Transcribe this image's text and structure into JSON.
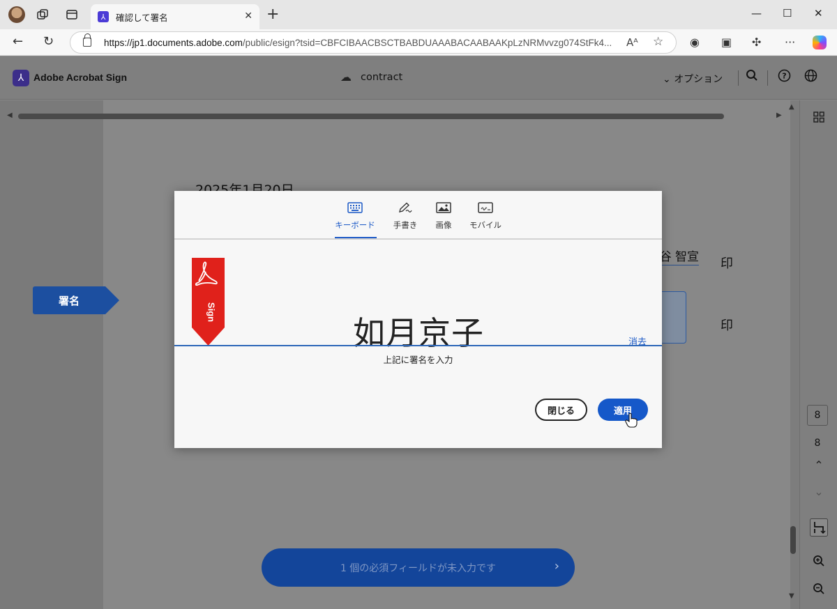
{
  "browser": {
    "tab_title": "確認して署名",
    "tab_close": "✕",
    "new_tab": "+",
    "url_host": "https://jp1.documents.adobe.com",
    "url_path": "/public/esign?tsid=CBFCIBAACBSCTBABDUAAABACAABAAKpLzNRMvvzg074StFk4...",
    "read_aloud": "Aᴬ",
    "window_minimize": "—",
    "window_maximize": "☐",
    "window_close": "✕"
  },
  "app_header": {
    "brand": "Adobe Acrobat Sign",
    "document_name": "contract",
    "options_label": "オプション"
  },
  "document": {
    "date": "2025年1月20日",
    "name_text": "谷 智宣",
    "seal_1": "印",
    "seal_2": "印",
    "sign_tag": "署名",
    "required_banner": "1 個の必須フィールドが未入力です"
  },
  "right_rail": {
    "current_page": "8",
    "total_pages": "8"
  },
  "signature_modal": {
    "tabs": [
      {
        "label": "キーボード",
        "icon": "keyboard-icon",
        "active": true
      },
      {
        "label": "手書き",
        "icon": "pen-icon",
        "active": false
      },
      {
        "label": "画像",
        "icon": "image-icon",
        "active": false
      },
      {
        "label": "モバイル",
        "icon": "mobile-icon",
        "active": false
      }
    ],
    "ribbon_text": "Sign",
    "signature_value": "如月京子",
    "clear_label": "消去",
    "caption": "上記に署名を入力",
    "close_button": "閉じる",
    "apply_button": "適用"
  },
  "colors": {
    "accent": "#1a58c6",
    "adobe_red": "#e0211b",
    "banner_blue": "#13459a"
  }
}
